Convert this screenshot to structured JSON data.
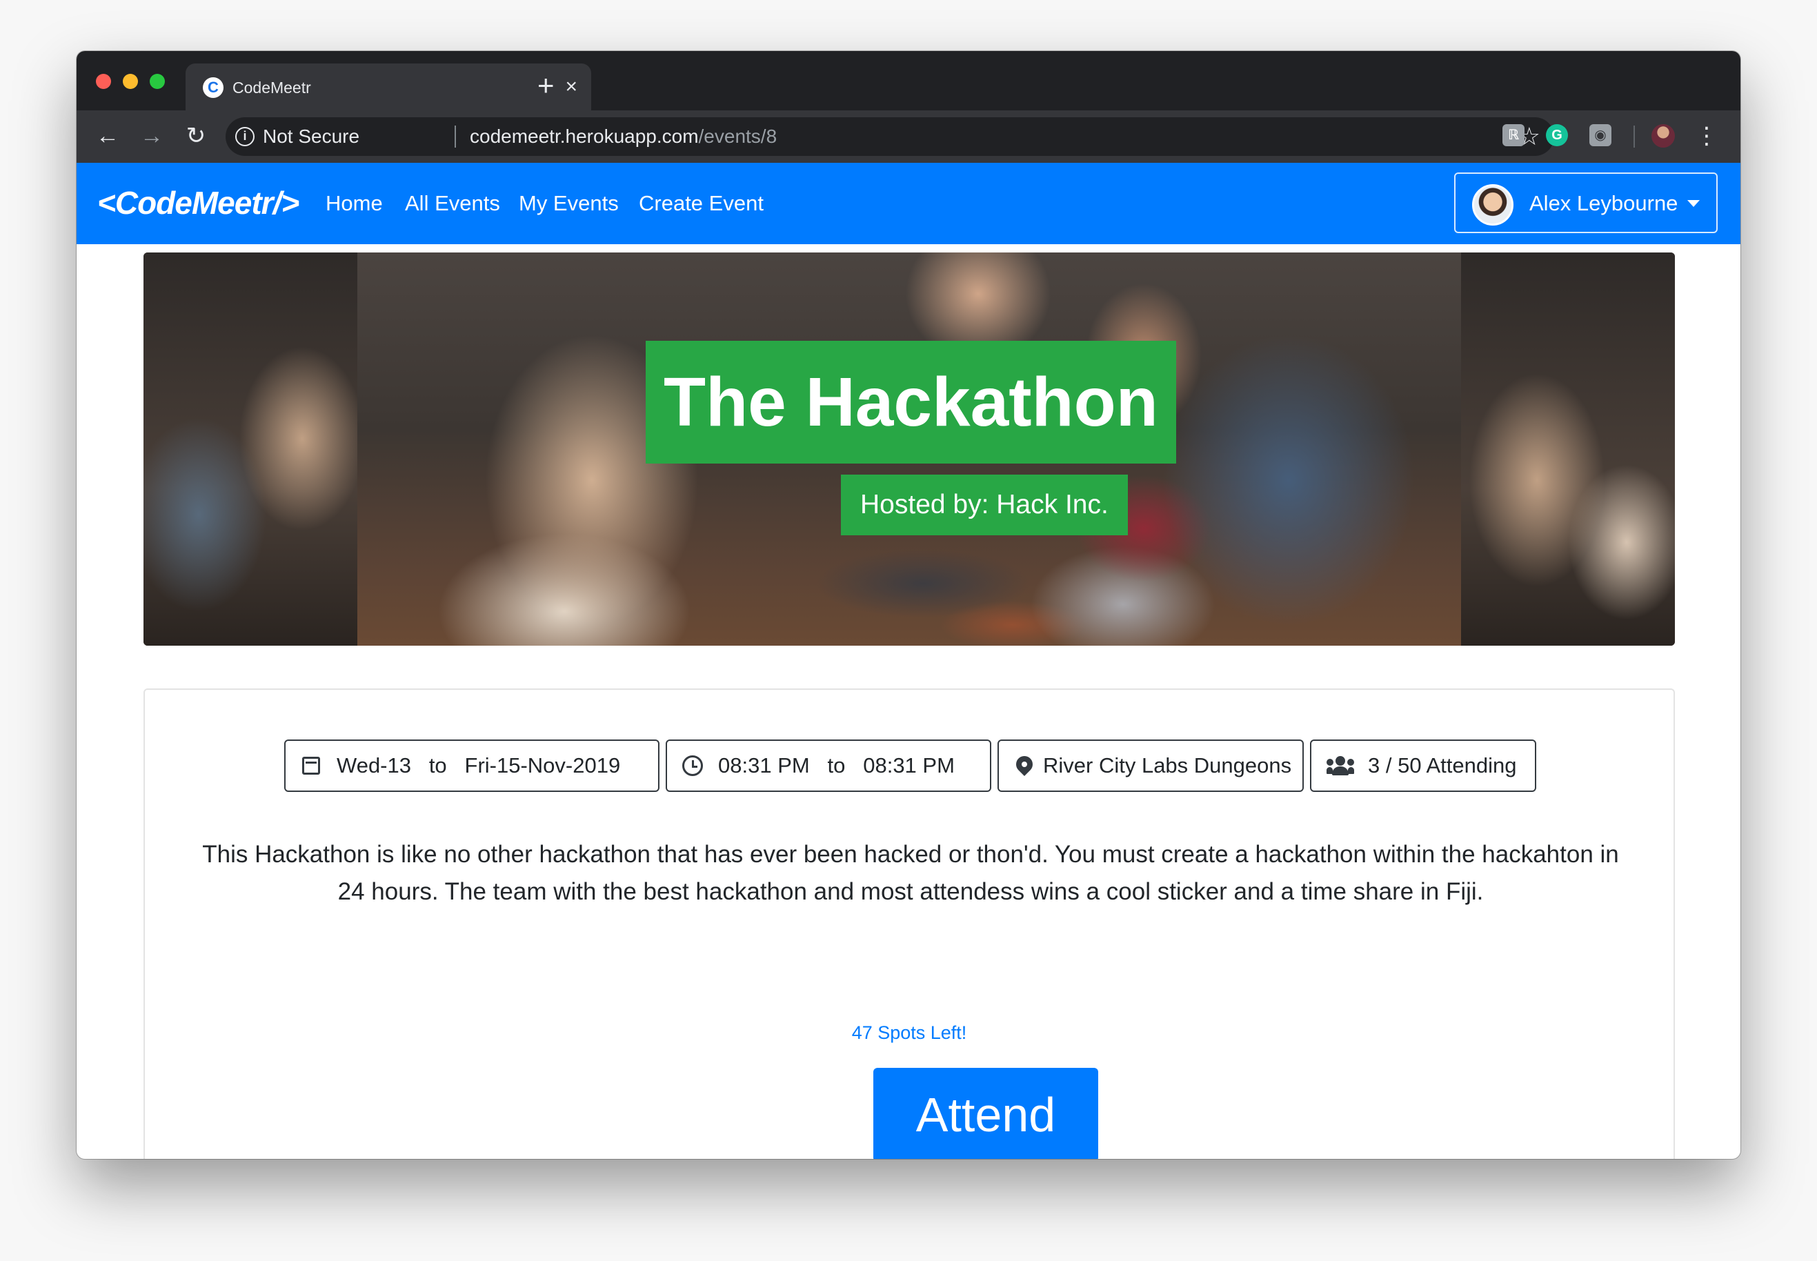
{
  "browser": {
    "tab_title": "CodeMeetr",
    "tab_close": "×",
    "new_tab": "+",
    "security_label": "Not Secure",
    "url_host": "codemeetr.herokuapp.com",
    "url_path": "/events/8"
  },
  "navbar": {
    "brand": "<CodeMeetr/>",
    "links": [
      "Home",
      "All Events",
      "My Events",
      "Create Event"
    ],
    "user_name": "Alex Leybourne"
  },
  "hero": {
    "title": "The Hackathon",
    "host": "Hosted by: Hack Inc."
  },
  "event": {
    "date_range": "Wed-13   to   Fri-15-Nov-2019",
    "time_range": "08:31 PM   to   08:31 PM",
    "location": "River City Labs Dungeons",
    "attending": "3 / 50 Attending",
    "description": "This Hackathon is like no other hackathon that has ever been hacked or thon'd. You must create a hackathon within the hackahton in 24 hours. The team with the best hackathon and most attendess wins a cool sticker and a time share in Fiji.",
    "spots_left": "47 Spots Left!",
    "attend_label": "Attend"
  },
  "colors": {
    "primary": "#007bff",
    "success": "#28a745",
    "chrome_dark": "#202124",
    "chrome_toolbar": "#35363a"
  },
  "icons": [
    "back-arrow-icon",
    "forward-arrow-icon",
    "reload-icon",
    "info-icon",
    "star-icon",
    "calendar-icon",
    "clock-icon",
    "map-pin-icon",
    "users-icon",
    "caret-down-icon"
  ]
}
